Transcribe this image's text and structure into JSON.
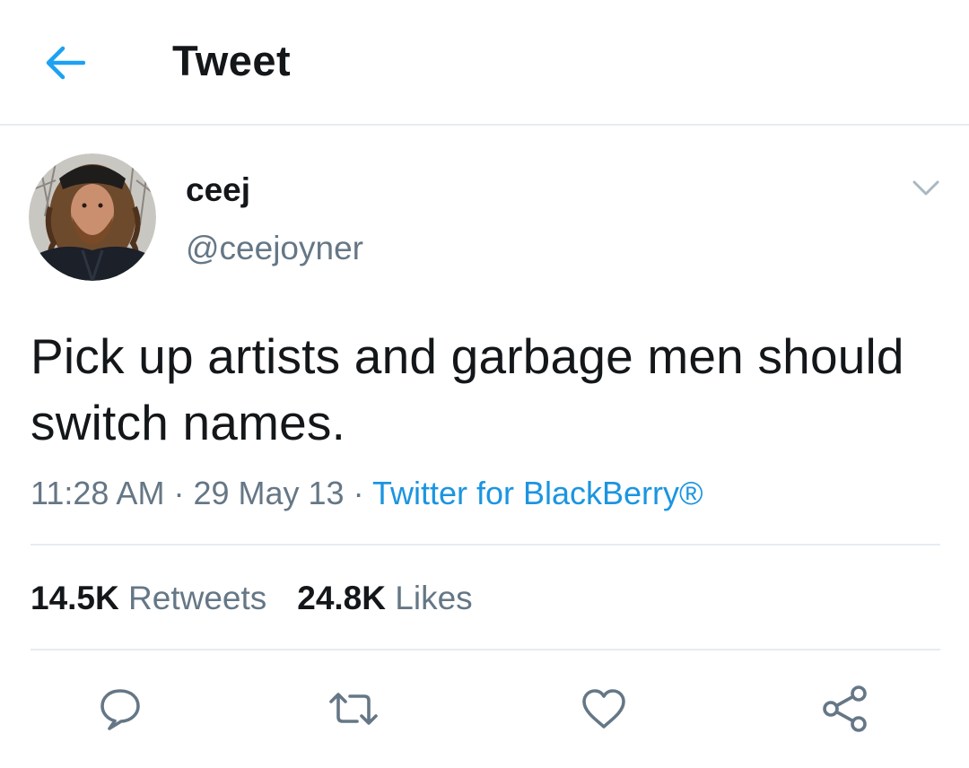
{
  "header": {
    "back_icon": "arrow-left-icon",
    "title": "Tweet",
    "accent_color": "#1da1f2"
  },
  "author": {
    "display_name": "ceej",
    "handle": "@ceejoyner",
    "avatar_icon": "avatar-photo",
    "menu_icon": "chevron-down-icon"
  },
  "tweet": {
    "text": "Pick up artists and garbage men should switch names.",
    "time": "11:28 AM",
    "date": "29 May 13",
    "separator": "·",
    "source": "Twitter for BlackBerry®",
    "source_color": "#1b95e0"
  },
  "stats": {
    "retweets_count": "14.5K",
    "retweets_label": "Retweets",
    "likes_count": "24.8K",
    "likes_label": "Likes"
  },
  "actions": [
    {
      "icon": "reply-icon"
    },
    {
      "icon": "retweet-icon"
    },
    {
      "icon": "heart-icon"
    },
    {
      "icon": "share-icon"
    }
  ]
}
